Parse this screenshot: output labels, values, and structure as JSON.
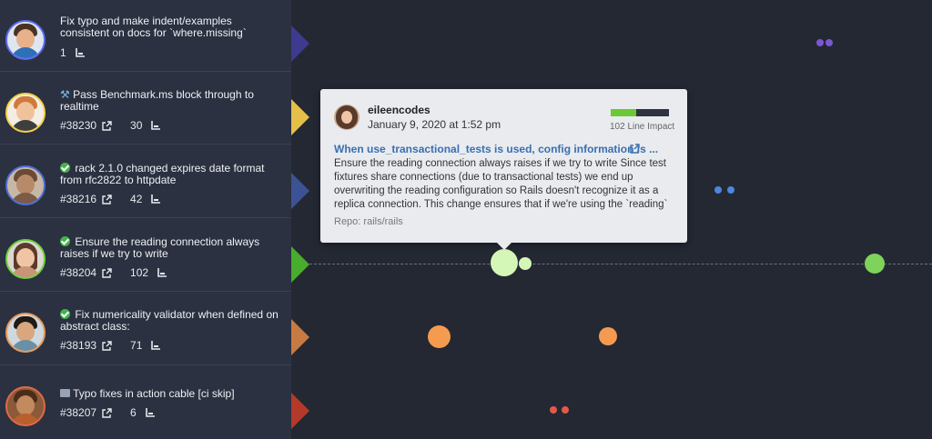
{
  "prs": [
    {
      "title": "Fix typo and make indent/examples consistent on docs for `where.missing`",
      "status": "none",
      "number": "",
      "lines": "1",
      "avatar": {
        "border": "#5b6cf0",
        "skin": "#e7b18c",
        "hair": "#4a3323",
        "shirt": "#2f6fb5"
      }
    },
    {
      "title": "Pass Benchmark.ms block through to realtime",
      "status": "hammer",
      "number": "#38230",
      "lines": "30",
      "avatar": {
        "border": "#f2d04b",
        "skin": "#efc29b",
        "hair": "#d07a3a",
        "shirt": "#3e3e3e"
      }
    },
    {
      "title": "rack 2.1.0 changed expires date format from rfc2822 to httpdate",
      "status": "check",
      "number": "#38216",
      "lines": "42",
      "avatar": {
        "border": "#4c6fd8",
        "skin": "#b88a6a",
        "hair": "#6a4a36",
        "shirt": "#7b5a46"
      }
    },
    {
      "title": "Ensure the reading connection always raises if we try to write",
      "status": "check",
      "number": "#38204",
      "lines": "102",
      "avatar": {
        "border": "#6fcf3f",
        "skin": "#f0c5a5",
        "hair": "#5a3a2a",
        "shirt": "#c99477"
      }
    },
    {
      "title": "Fix numericality validator when defined on abstract class:",
      "status": "check",
      "number": "#38193",
      "lines": "71",
      "avatar": {
        "border": "#e89a5a",
        "skin": "#d9a67e",
        "hair": "#1f1a17",
        "shirt": "#6b8fa5"
      }
    },
    {
      "title": "Typo fixes in action cable [ci skip]",
      "status": "comment",
      "number": "#38207",
      "lines": "6",
      "avatar": {
        "border": "#e16a48",
        "skin": "#c28a5e",
        "hair": "#4b2c17",
        "shirt": "#b8602e"
      }
    }
  ],
  "triangle_colors": [
    "#3d3a8f",
    "#e5c048",
    "#3d5294",
    "#48ad2c",
    "#c77b43",
    "#b33a2a"
  ],
  "tooltip": {
    "username": "eileencodes",
    "date": "January 9, 2020 at 1:52 pm",
    "line_impact": "102 Line Impact",
    "title": "When use_transactional_tests is used, config information is ...",
    "body": "Ensure the reading connection always raises if we try to write Since test fixtures share connections (due to transactional tests) we end up overwriting the reading configuration so Rails doesn't recognize it as a replica connection. This change ensures that if we're using the `reading`",
    "repo": "Repo: rails/rails"
  }
}
